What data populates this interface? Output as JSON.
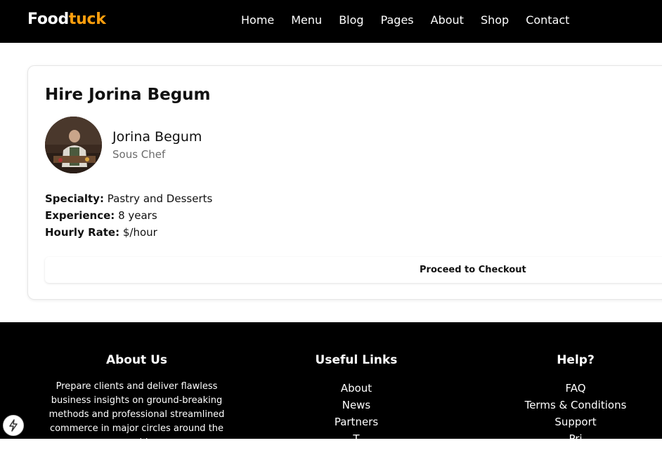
{
  "header": {
    "logo_part1": "Food",
    "logo_part2": "tuck",
    "nav": [
      "Home",
      "Menu",
      "Blog",
      "Pages",
      "About",
      "Shop",
      "Contact"
    ]
  },
  "hire": {
    "title": "Hire Jorina Begum",
    "chef_name": "Jorina Begum",
    "chef_role": "Sous Chef",
    "specialty_label": "Specialty:",
    "specialty_value": "Pastry and Desserts",
    "experience_label": "Experience:",
    "experience_value": "8 years",
    "rate_label": "Hourly Rate:",
    "rate_value": "$/hour",
    "checkout_label": "Proceed to Checkout"
  },
  "footer": {
    "about_title": "About Us",
    "about_text": "Prepare clients and deliver flawless business insights on ground-breaking methods and professional streamlined commerce in major circles around the world.",
    "links_title": "Useful Links",
    "links": [
      "About",
      "News",
      "Partners",
      "T"
    ],
    "help_title": "Help?",
    "help_links": [
      "FAQ",
      "Terms & Conditions",
      "Support",
      "Pri"
    ]
  },
  "icons": {
    "floating_button": "lightning-icon"
  },
  "colors": {
    "logo_accent": "#FF9F0D",
    "header_bg": "#000000",
    "footer_bg": "#000000"
  }
}
